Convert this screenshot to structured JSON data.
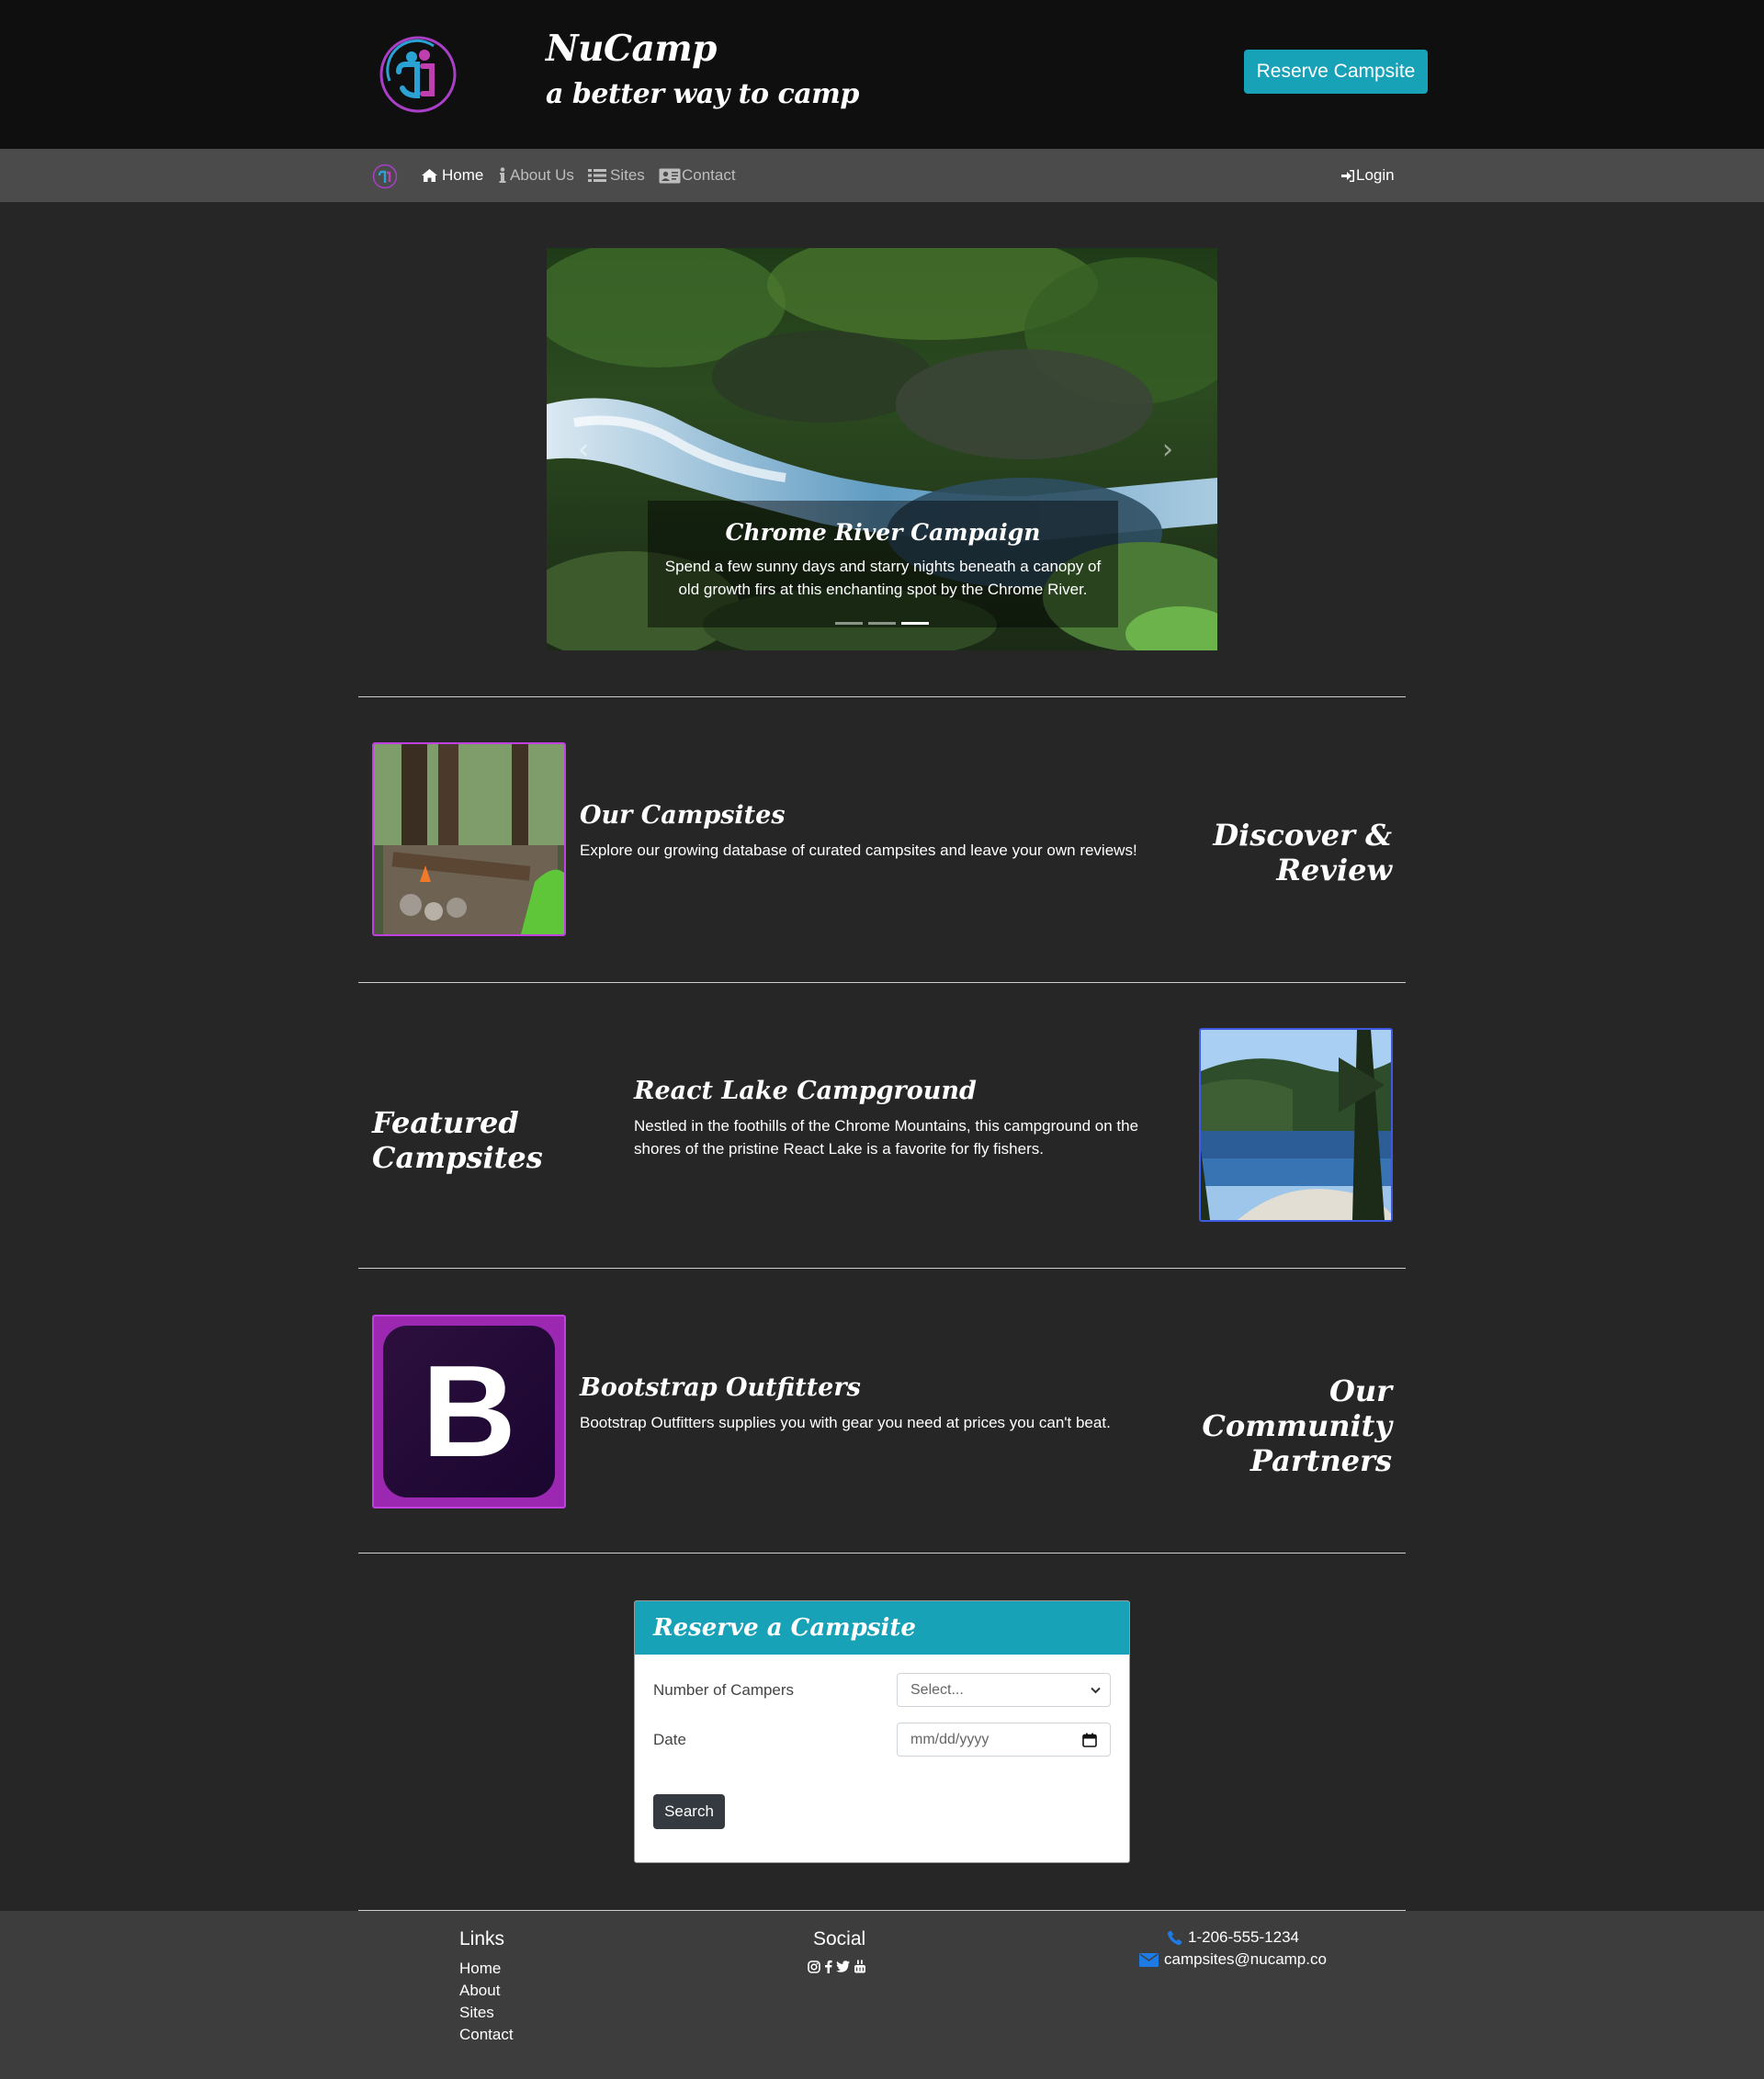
{
  "header": {
    "brand_title": "NuCamp",
    "brand_subtitle": "a better way to camp",
    "reserve_button": "Reserve Campsite"
  },
  "nav": {
    "items": [
      {
        "label": "Home",
        "icon": "home-icon",
        "active": true
      },
      {
        "label": "About Us",
        "icon": "info-icon",
        "active": false
      },
      {
        "label": "Sites",
        "icon": "list-icon",
        "active": false
      },
      {
        "label": "Contact",
        "icon": "address-card-icon",
        "active": false
      }
    ],
    "login": "Login"
  },
  "carousel": {
    "caption_title": "Chrome River Campaign",
    "caption_text": "Spend a few sunny days and starry nights beneath a canopy of old growth firs at this enchanting spot by the Chrome River.",
    "indicator_count": 3,
    "active_index": 2
  },
  "sections": {
    "campsites": {
      "title": "Our Campsites",
      "text": "Explore our growing database of curated campsites and leave your own reviews!",
      "side_heading": "Discover & Review"
    },
    "featured": {
      "side_heading": "Featured Campsites",
      "title": "React Lake Campground",
      "text": "Nestled in the foothills of the Chrome Mountains, this campground on the shores of the pristine React Lake is a favorite for fly fishers."
    },
    "partners": {
      "logo_letter": "B",
      "title": "Bootstrap Outfitters",
      "text": "Bootstrap Outfitters supplies you with gear you need at prices you can't beat.",
      "side_heading_line1": "Our Community",
      "side_heading_line2": "Partners"
    }
  },
  "reserve_form": {
    "title": "Reserve a Campsite",
    "campers_label": "Number of Campers",
    "campers_value": "Select...",
    "date_label": "Date",
    "date_placeholder": "mm/dd/yyyy",
    "search_button": "Search"
  },
  "footer": {
    "links_heading": "Links",
    "links": [
      "Home",
      "About",
      "Sites",
      "Contact"
    ],
    "social_heading": "Social",
    "social_icons": [
      "instagram-icon",
      "facebook-icon",
      "twitter-icon",
      "youtube-icon"
    ],
    "phone": "1-206-555-1234",
    "email": "campsites@nucamp.co"
  },
  "colors": {
    "accent": "#17a2b8",
    "background": "#262627",
    "header_bg": "#0f0f10",
    "navbar_bg": "#4b4b4c",
    "footer_bg": "#3d3d3e",
    "link_blue": "#1e7be6"
  }
}
